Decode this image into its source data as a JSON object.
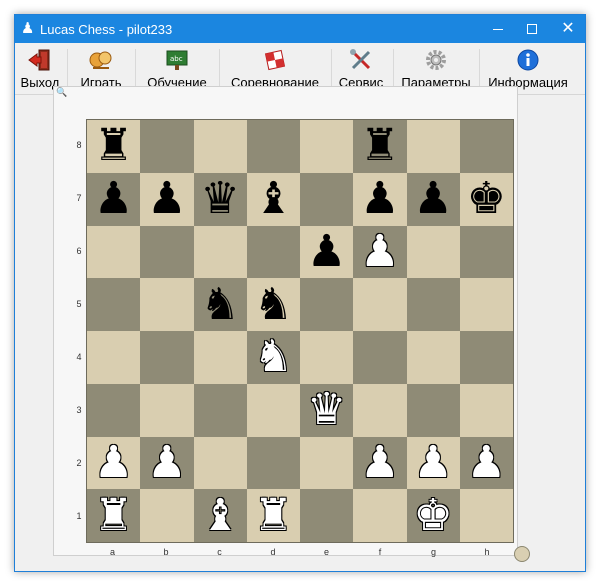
{
  "window": {
    "title": "Lucas Chess - pilot233",
    "app_icon": "chess-pawn-icon",
    "minimize_glyph": "",
    "maximize_glyph": "",
    "close_glyph": "✕"
  },
  "toolbar": {
    "items": [
      {
        "label": "Выход",
        "icon": "exit-door-icon"
      },
      {
        "label": "Играть",
        "icon": "play-icon"
      },
      {
        "label": "Обучение",
        "icon": "training-board-icon"
      },
      {
        "label": "Соревнование",
        "icon": "competition-icon"
      },
      {
        "label": "Сервис",
        "icon": "tools-icon"
      },
      {
        "label": "Параметры",
        "icon": "gear-icon"
      },
      {
        "label": "Информация",
        "icon": "info-icon"
      }
    ]
  },
  "board": {
    "ranks": [
      "8",
      "7",
      "6",
      "5",
      "4",
      "3",
      "2",
      "1"
    ],
    "files": [
      "a",
      "b",
      "c",
      "d",
      "e",
      "f",
      "g",
      "h"
    ],
    "rows": [
      [
        "r",
        "",
        "",
        "",
        "",
        "r",
        "",
        ""
      ],
      [
        "p",
        "p",
        "q",
        "b",
        "",
        "p",
        "p",
        "k"
      ],
      [
        "",
        "",
        "",
        "",
        "p",
        "P",
        "",
        ""
      ],
      [
        "",
        "",
        "n",
        "n",
        "",
        "",
        "",
        ""
      ],
      [
        "",
        "",
        "",
        "N",
        "",
        "",
        "",
        ""
      ],
      [
        "",
        "",
        "",
        "",
        "Q",
        "",
        "",
        ""
      ],
      [
        "P",
        "P",
        "",
        "",
        "",
        "P",
        "P",
        "P"
      ],
      [
        "R",
        "",
        "B",
        "R",
        "",
        "",
        "K",
        ""
      ]
    ],
    "light_color": "#d9ceb0",
    "dark_color": "#8f8b76"
  }
}
